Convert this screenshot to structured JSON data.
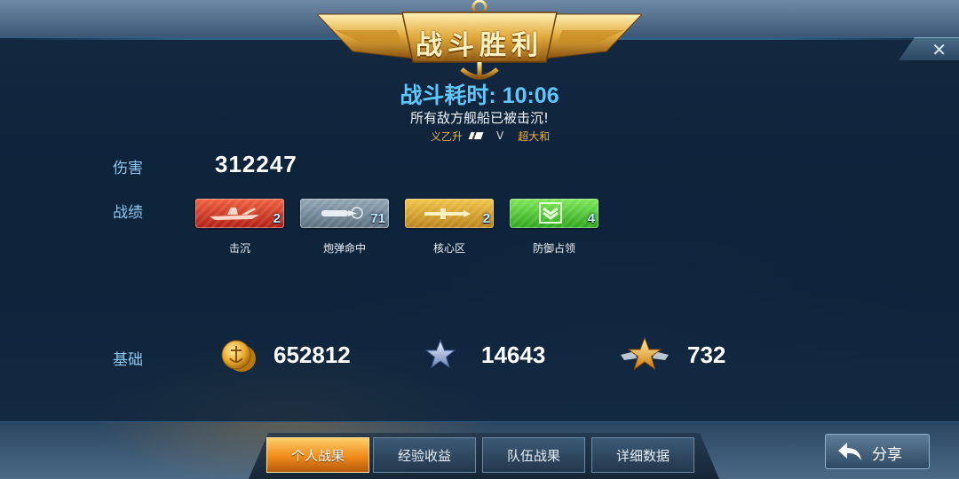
{
  "header": {
    "title": "战斗胜利",
    "duration_label": "战斗耗时: 10:06",
    "message": "所有敌方舰船已被击沉!",
    "player_ship": "义乙升",
    "vs": "V",
    "enemy_ship": "超大和",
    "close_label": "✕"
  },
  "stats": {
    "damage_label": "伤害",
    "damage_value": "312247",
    "record_label": "战绩",
    "records": [
      {
        "label": "击沉",
        "count": "2",
        "icon": "sink-ship-icon",
        "color": "#d8342a"
      },
      {
        "label": "炮弹命中",
        "count": "71",
        "icon": "shell-hit-icon",
        "color": "#7a8fa0"
      },
      {
        "label": "核心区",
        "count": "2",
        "icon": "core-zone-icon",
        "color": "#e0a830"
      },
      {
        "label": "防御占领",
        "count": "4",
        "icon": "defense-capture-icon",
        "color": "#56c83a"
      }
    ],
    "base_label": "基础",
    "base": [
      {
        "icon": "gold-coin-icon",
        "value": "652812"
      },
      {
        "icon": "silver-star-icon",
        "value": "14643"
      },
      {
        "icon": "gold-winged-star-icon",
        "value": "732"
      }
    ]
  },
  "tabs": [
    {
      "label": "个人战果",
      "active": true
    },
    {
      "label": "经验收益",
      "active": false
    },
    {
      "label": "队伍战果",
      "active": false
    },
    {
      "label": "详细数据",
      "active": false
    }
  ],
  "share": {
    "label": "分享"
  }
}
